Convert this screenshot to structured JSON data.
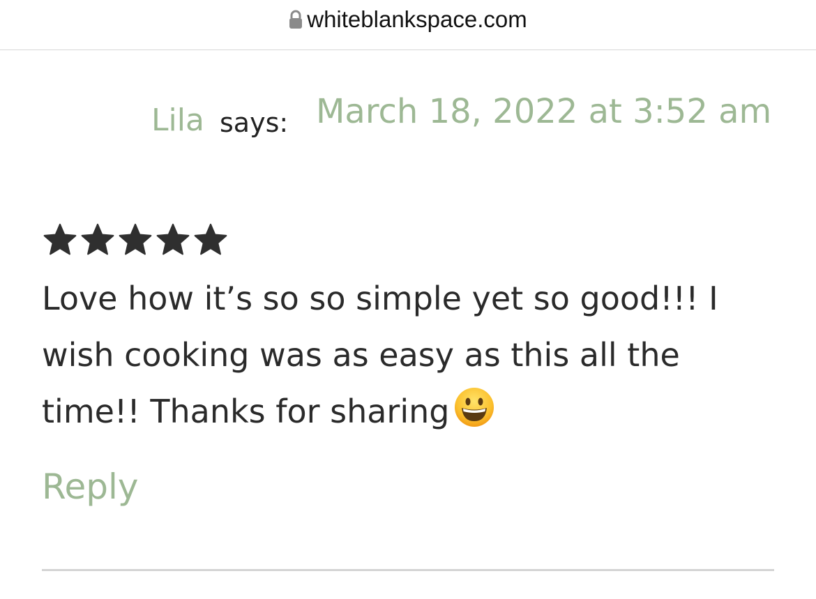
{
  "browser": {
    "url": "whiteblankspace.com",
    "lock_icon": "lock-icon"
  },
  "comment": {
    "author": "Lila",
    "says": "says:",
    "date": "March 18, 2022 at 3:52 am",
    "rating": 5,
    "rating_max": 5,
    "text": "Love how it’s so so simple yet so good!!! I wish cooking was as easy as this all the time!! Thanks for sharing",
    "emoji": "grinning-face-icon",
    "reply_label": "Reply"
  },
  "colors": {
    "accent": "#9db894",
    "text": "#2a2a2a",
    "star": "#2f2f2f"
  }
}
